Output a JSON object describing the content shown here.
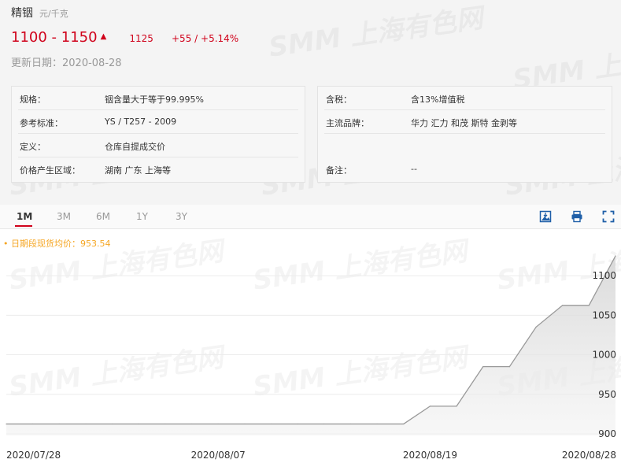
{
  "product": {
    "name": "精铟",
    "unit": "元/千克"
  },
  "price": {
    "range": "1100 - 1150",
    "avg": "1125",
    "change": "+55",
    "separator": "/",
    "change_pct": "+5.14%",
    "updated_label": "更新日期：",
    "updated_date": "2020-08-28"
  },
  "specs_left": [
    {
      "k": "规格：",
      "v": "铟含量大于等于99.995%"
    },
    {
      "k": "参考标准：",
      "v": "YS / T257 - 2009"
    },
    {
      "k": "定义：",
      "v": "仓库自提成交价"
    },
    {
      "k": "价格产生区域：",
      "v": "湖南 广东 上海等"
    }
  ],
  "specs_right": [
    {
      "k": "含税：",
      "v": "含13%增值税"
    },
    {
      "k": "主流品牌：",
      "v": "华力 汇力 和茂 斯特 金剥等"
    },
    {
      "k": "",
      "v": ""
    },
    {
      "k": "备注：",
      "v": "--"
    }
  ],
  "tabs": [
    "1M",
    "3M",
    "6M",
    "1Y",
    "3Y"
  ],
  "active_tab": "1M",
  "icons": [
    "download-image-icon",
    "print-icon",
    "fullscreen-icon"
  ],
  "watermark": "SMM 上海有色网",
  "legend": "• 日期段现货均价：953.54",
  "chart_data": {
    "type": "area",
    "x": [
      "2020-07-28",
      "2020-07-29",
      "2020-07-30",
      "2020-07-31",
      "2020-08-03",
      "2020-08-04",
      "2020-08-05",
      "2020-08-06",
      "2020-08-07",
      "2020-08-10",
      "2020-08-11",
      "2020-08-12",
      "2020-08-13",
      "2020-08-14",
      "2020-08-17",
      "2020-08-18",
      "2020-08-19",
      "2020-08-20",
      "2020-08-21",
      "2020-08-24",
      "2020-08-25",
      "2020-08-26",
      "2020-08-27",
      "2020-08-28"
    ],
    "values": [
      912.5,
      912.5,
      912.5,
      912.5,
      912.5,
      912.5,
      912.5,
      912.5,
      912.5,
      912.5,
      912.5,
      912.5,
      912.5,
      912.5,
      912.5,
      912.5,
      935,
      935,
      985,
      985,
      1035,
      1062.5,
      1062.5,
      1125
    ],
    "x_tick_labels": [
      "2020/07/28",
      "2020/08/07",
      "2020/08/19",
      "2020/08/28"
    ],
    "y_ticks": [
      900,
      950,
      1000,
      1050,
      1100
    ],
    "ylim": [
      898,
      1130
    ],
    "grid": true,
    "color": "#999999",
    "average": 953.54
  }
}
